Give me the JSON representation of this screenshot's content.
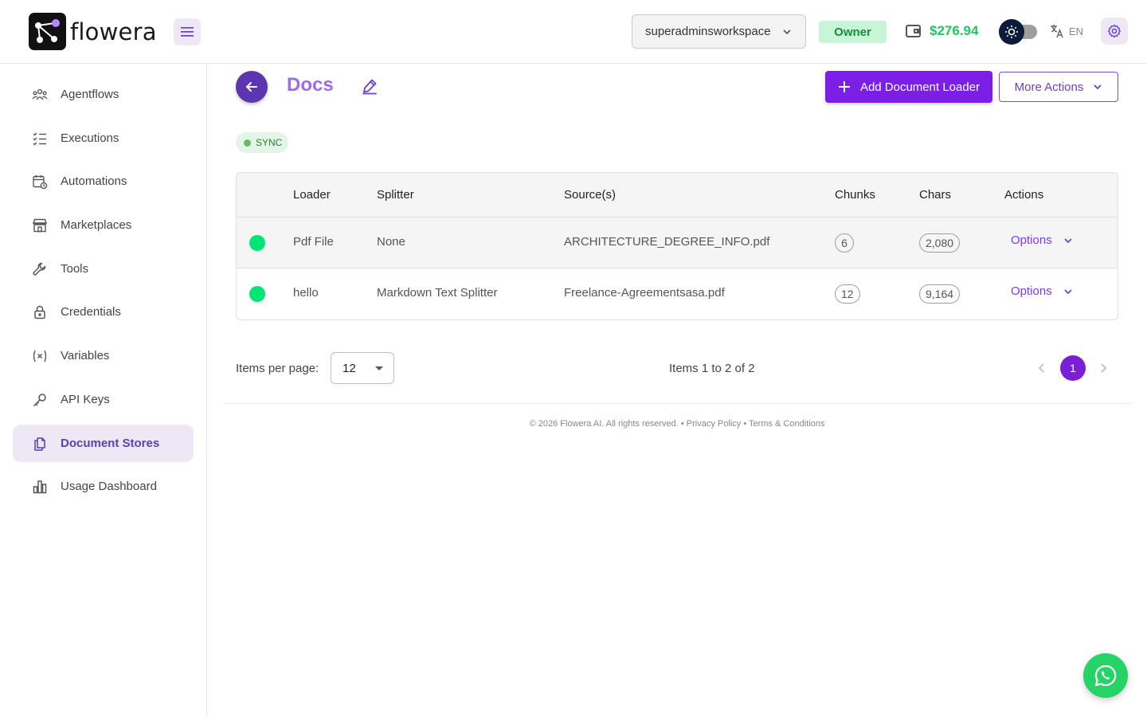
{
  "app": {
    "name": "flowera"
  },
  "header": {
    "workspace": "superadminsworkspace",
    "role_badge": "Owner",
    "balance": "$276.94",
    "language": "EN"
  },
  "sidebar": {
    "items": [
      {
        "label": "Agentflows",
        "icon": "agentflows-icon"
      },
      {
        "label": "Executions",
        "icon": "executions-icon"
      },
      {
        "label": "Automations",
        "icon": "calendar-clock-icon"
      },
      {
        "label": "Marketplaces",
        "icon": "store-icon"
      },
      {
        "label": "Tools",
        "icon": "wrench-icon"
      },
      {
        "label": "Credentials",
        "icon": "lock-icon"
      },
      {
        "label": "Variables",
        "icon": "variable-icon"
      },
      {
        "label": "API Keys",
        "icon": "key-icon"
      },
      {
        "label": "Document Stores",
        "icon": "files-icon",
        "active": true
      },
      {
        "label": "Usage Dashboard",
        "icon": "bar-chart-icon"
      }
    ]
  },
  "main": {
    "title": "Docs",
    "add_button": "Add Document Loader",
    "more_button": "More Actions",
    "status_badge": "SYNC",
    "table": {
      "headers": [
        "Loader",
        "Splitter",
        "Source(s)",
        "Chunks",
        "Chars",
        "Actions"
      ],
      "rows": [
        {
          "loader": "Pdf File",
          "splitter": "None",
          "source": "ARCHITECTURE_DEGREE_INFO.pdf",
          "chunks": "6",
          "chars": "2,080",
          "action": "Options"
        },
        {
          "loader": "hello",
          "splitter": "Markdown Text Splitter",
          "source": "Freelance-Agreementsasa.pdf",
          "chunks": "12",
          "chars": "9,164",
          "action": "Options"
        }
      ]
    },
    "pagination": {
      "items_per_page_label": "Items per page:",
      "items_per_page": "12",
      "info": "Items 1 to 2 of 2",
      "current_page": "1"
    }
  },
  "footer": {
    "text": "© 2026 Flowera AI. All rights reserved. • Privacy Policy • Terms & Conditions"
  },
  "colors": {
    "accent": "#7c1fe6",
    "title": "#9c6ce6",
    "success": "#00e676",
    "balance": "#22c55e"
  }
}
